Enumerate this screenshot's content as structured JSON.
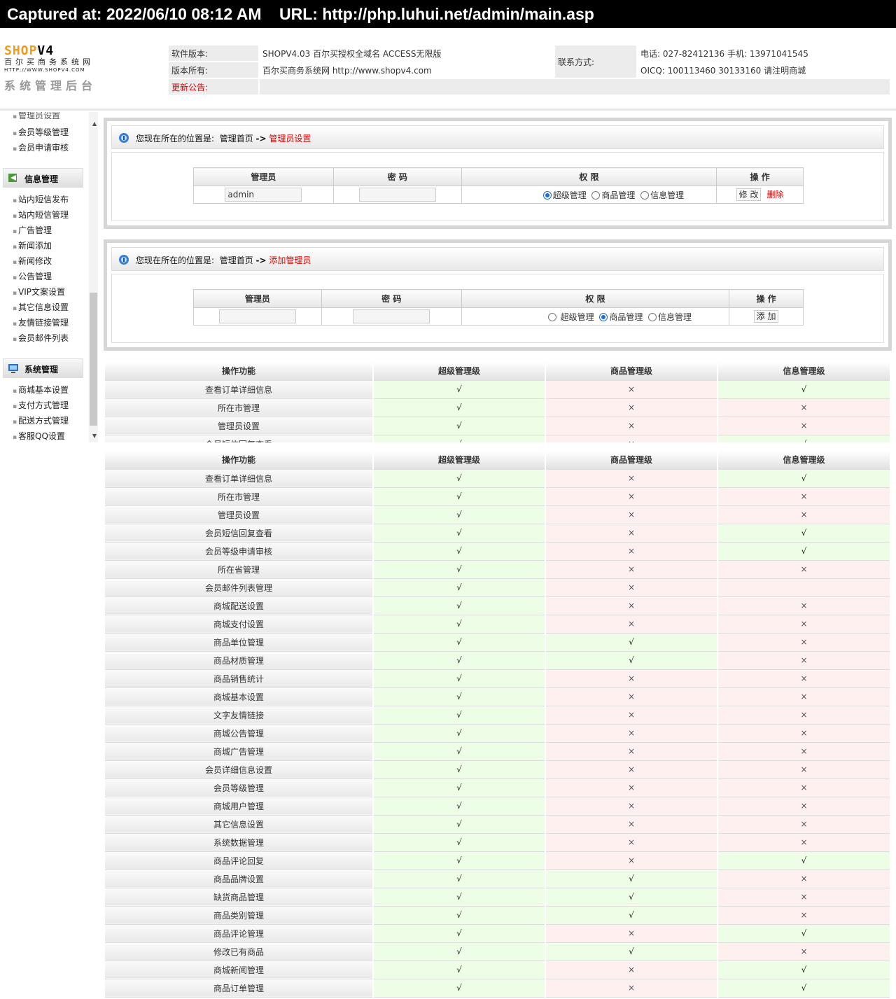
{
  "capture": {
    "text": "Captured at: 2022/06/10 08:12 AM    URL: http://php.luhui.net/admin/main.asp"
  },
  "logo": {
    "brand_a": "SHOP",
    "brand_b": "V4",
    "cn": "百尔买商务系统网",
    "url": "HTTP://WWW.SHOPV4.COM",
    "sys": "系统管理后台"
  },
  "header": {
    "version_label": "软件版本:",
    "version_value": "SHOPV4.03 百尔买授权全域名 ACCESS无限版",
    "owner_label": "版本所有:",
    "owner_value": "百尔买商务系统网 http://www.shopv4.com",
    "notice_label": "更新公告:",
    "contact_label": "联系方式:",
    "phone": "电话: 027-82412136 手机: 13971041545",
    "qq": "OICQ: 100113460 30133160 请注明商城"
  },
  "sidebar": {
    "top_items": [
      "管理员设置",
      "会员等级管理",
      "会员申请审核"
    ],
    "section1": "信息管理",
    "info_items": [
      "站内短信发布",
      "站内短信管理",
      "广告管理",
      "新闻添加",
      "新闻修改",
      "公告管理",
      "VIP文案设置",
      "其它信息设置",
      "友情链接管理",
      "会员邮件列表"
    ],
    "section2": "系统管理",
    "sys_items": [
      "商城基本设置",
      "支付方式管理",
      "配送方式管理",
      "客服QQ设置"
    ]
  },
  "panel1": {
    "location_prefix": "您现在所在的位置是:",
    "home": "管理首页",
    "arrow": "->",
    "current": "管理员设置",
    "headers": [
      "管理员",
      "密 码",
      "权 限",
      "操 作"
    ],
    "row": {
      "admin": "admin",
      "perms": [
        "超级管理",
        "商品管理",
        "信息管理"
      ],
      "selected": 0,
      "edit": "修 改",
      "delete": "删除"
    }
  },
  "panel2": {
    "location_prefix": "您现在所在的位置是:",
    "home": "管理首页",
    "arrow": "->",
    "current": "添加管理员",
    "headers": [
      "管理员",
      "密 码",
      "权 限",
      "操 作"
    ],
    "row": {
      "perms": [
        "超级管理",
        "商品管理",
        "信息管理"
      ],
      "selected": 1,
      "add": "添 加"
    }
  },
  "permissions": {
    "headers": [
      "操作功能",
      "超级管理级",
      "商品管理级",
      "信息管理级"
    ],
    "yes": "√",
    "no": "×",
    "rows": [
      {
        "name": "查看订单详细信息",
        "s": 1,
        "p": 0,
        "i": 1
      },
      {
        "name": "所在市管理",
        "s": 1,
        "p": 0,
        "i": 0
      },
      {
        "name": "管理员设置",
        "s": 1,
        "p": 0,
        "i": 0
      },
      {
        "name": "会员短信回复查看",
        "s": 1,
        "p": 0,
        "i": 1
      },
      {
        "name": "会员等级申请审核",
        "s": 1,
        "p": 0,
        "i": 1
      },
      {
        "name": "所在省管理",
        "s": 1,
        "p": 0,
        "i": 0
      },
      {
        "name": "会员邮件列表管理",
        "s": 1,
        "p": 0,
        "i": -1
      },
      {
        "name": "商城配送设置",
        "s": 1,
        "p": 0,
        "i": 0
      },
      {
        "name": "商城支付设置",
        "s": 1,
        "p": 0,
        "i": 0
      },
      {
        "name": "商品单位管理",
        "s": 1,
        "p": 1,
        "i": 0
      },
      {
        "name": "商品材质管理",
        "s": 1,
        "p": 1,
        "i": 0
      },
      {
        "name": "商品销售统计",
        "s": 1,
        "p": 0,
        "i": 0
      },
      {
        "name": "商城基本设置",
        "s": 1,
        "p": 0,
        "i": 0
      },
      {
        "name": "文字友情链接",
        "s": 1,
        "p": 0,
        "i": 0
      },
      {
        "name": "商城公告管理",
        "s": 1,
        "p": 0,
        "i": 0
      },
      {
        "name": "商城广告管理",
        "s": 1,
        "p": 0,
        "i": 0
      },
      {
        "name": "会员详细信息设置",
        "s": 1,
        "p": 0,
        "i": 0
      },
      {
        "name": "会员等级管理",
        "s": 1,
        "p": 0,
        "i": 0
      },
      {
        "name": "商城用户管理",
        "s": 1,
        "p": 0,
        "i": 0
      },
      {
        "name": "其它信息设置",
        "s": 1,
        "p": 0,
        "i": 0
      },
      {
        "name": "系统数据管理",
        "s": 1,
        "p": 0,
        "i": 0
      },
      {
        "name": "商品评论回复",
        "s": 1,
        "p": 0,
        "i": 1
      },
      {
        "name": "商品品牌设置",
        "s": 1,
        "p": 1,
        "i": 0
      },
      {
        "name": "缺货商品管理",
        "s": 1,
        "p": 1,
        "i": 0
      },
      {
        "name": "商品类别管理",
        "s": 1,
        "p": 1,
        "i": 0
      },
      {
        "name": "商品评论管理",
        "s": 1,
        "p": 0,
        "i": 1
      },
      {
        "name": "修改已有商品",
        "s": 1,
        "p": 1,
        "i": 0
      },
      {
        "name": "商城新闻管理",
        "s": 1,
        "p": 0,
        "i": 1
      },
      {
        "name": "商品订单管理",
        "s": 1,
        "p": 0,
        "i": 1
      }
    ]
  },
  "colors": {
    "yes_bg": "#eefde6",
    "no_bg": "#fff0f0",
    "accent_red": "#e00000",
    "brand_orange": "#f29a1a"
  }
}
